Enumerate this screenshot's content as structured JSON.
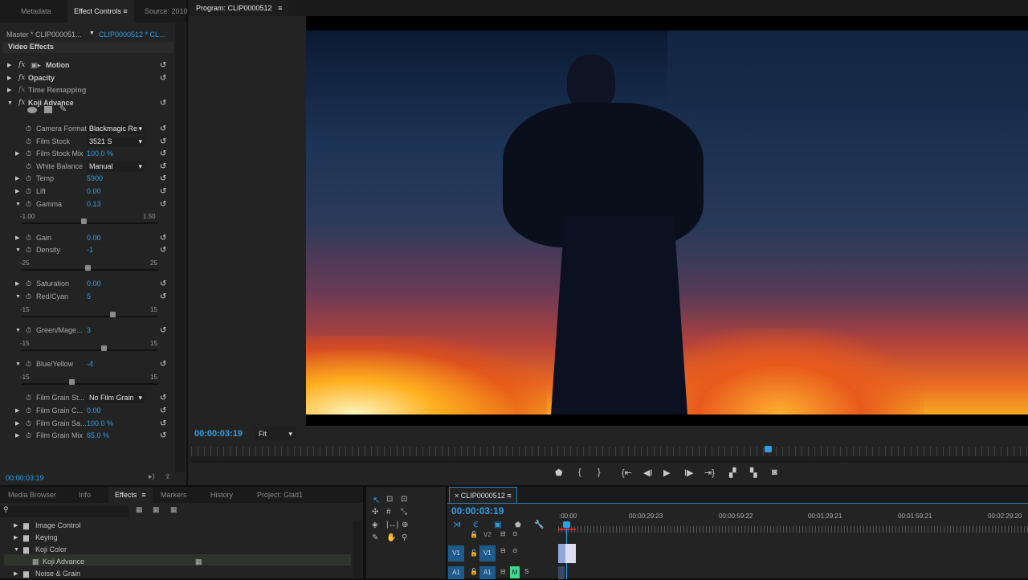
{
  "effect_panel": {
    "tabs": [
      "Metadata",
      "Effect Controls",
      "Source: 2010"
    ],
    "master_label": "Master * CLIP000051...",
    "clip_label": "CLIP0000512 * CL...",
    "section": "Video Effects",
    "effects": [
      {
        "label": "Motion"
      },
      {
        "label": "Opacity"
      },
      {
        "label": "Time Remapping"
      },
      {
        "label": "Koji Advance"
      }
    ],
    "params": [
      {
        "label": "Camera Format",
        "type": "dropdown",
        "value": "Blackmagic Re",
        "expand": false
      },
      {
        "label": "Film Stock",
        "type": "dropdown",
        "value": "3521 S",
        "expand": false
      },
      {
        "label": "Film Stock Mix",
        "type": "value",
        "value": "100.0 %",
        "expand": true
      },
      {
        "label": "White Balance",
        "type": "dropdown",
        "value": "Manual",
        "expand": false
      },
      {
        "label": "Temp",
        "type": "value",
        "value": "5900",
        "expand": true
      },
      {
        "label": "Lift",
        "type": "value",
        "value": "0.00",
        "expand": true
      },
      {
        "label": "Gamma",
        "type": "slider",
        "value": "0.13",
        "num": 0.13,
        "min": -1,
        "max": 1.5,
        "min_label": "-1.00",
        "max_label": "1.50"
      },
      {
        "label": "Gain",
        "type": "value",
        "value": "0.00",
        "expand": true
      },
      {
        "label": "Density",
        "type": "slider",
        "value": "-1",
        "num": -1,
        "min": -25,
        "max": 25,
        "min_label": "-25",
        "max_label": "25"
      },
      {
        "label": "Saturation",
        "type": "value",
        "value": "0.00",
        "expand": true
      },
      {
        "label": "Red/Cyan",
        "type": "slider",
        "value": "5",
        "num": 5,
        "min": -15,
        "max": 15,
        "min_label": "-15",
        "max_label": "15"
      },
      {
        "label": "Green/Mage...",
        "type": "slider",
        "value": "3",
        "num": 3,
        "min": -15,
        "max": 15,
        "min_label": "-15",
        "max_label": "15"
      },
      {
        "label": "Blue/Yellow",
        "type": "slider",
        "value": "-4",
        "num": -4,
        "min": -15,
        "max": 15,
        "min_label": "-15",
        "max_label": "15"
      },
      {
        "label": "Film Grain St...",
        "type": "dropdown",
        "value": "No Film Grain",
        "expand": false
      },
      {
        "label": "Film Grain C...",
        "type": "value",
        "value": "0.00",
        "expand": true
      },
      {
        "label": "Film Grain Sa...",
        "type": "value",
        "value": "100.0 %",
        "expand": true
      },
      {
        "label": "Film Grain Mix",
        "type": "value",
        "value": "65.0 %",
        "expand": true
      }
    ],
    "timecode": "00:00:03:19"
  },
  "program": {
    "tab": "Program: CLIP0000512",
    "timecode": "00:00:03:19",
    "zoom": "Fit"
  },
  "effects_browser": {
    "tabs": [
      "Media Browser",
      "Info",
      "Effects",
      "Markers",
      "History",
      "Project: Glad1"
    ],
    "items": [
      {
        "label": "Image Control"
      },
      {
        "label": "Keying"
      },
      {
        "label": "Koji Color"
      },
      {
        "label": "Koji Advance"
      },
      {
        "label": "Noise & Grain"
      }
    ]
  },
  "timeline": {
    "tab": "CLIP0000512",
    "timecode": "00:00:03:19",
    "ruler": [
      ":00:00",
      "00:00:29:23",
      "00:00:59:22",
      "00:01:29:21",
      "00:01:59:21",
      "00:02:29:20"
    ],
    "tracks": {
      "v2": "V2",
      "v1": "V1",
      "a1": "A1",
      "m": "M",
      "s": "S"
    }
  }
}
